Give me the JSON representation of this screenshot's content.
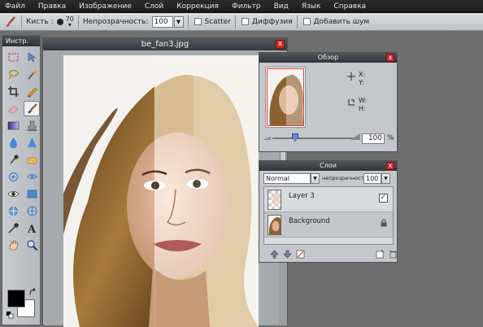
{
  "menu": [
    "Файл",
    "Правка",
    "Изображение",
    "Слой",
    "Коррекция",
    "Фильтр",
    "Вид",
    "Язык",
    "Справка"
  ],
  "options": {
    "brush_label": "Кисть :",
    "brush_size": "70",
    "opacity_label": "Непрозрачность:",
    "opacity_value": "100",
    "scatter_label": "Scatter",
    "diffusion_label": "Диффузия",
    "add_noise_label": "Добавить шум"
  },
  "tools": {
    "title": "Инстр.",
    "items": [
      "marquee",
      "move",
      "lasso",
      "magic-wand",
      "crop",
      "pencil",
      "eraser",
      "brush",
      "gradient",
      "stamp",
      "blur",
      "sharpen",
      "burn",
      "sponge",
      "dodge",
      "replace-color",
      "eye",
      "shape",
      "clone",
      "target",
      "eyedropper",
      "type",
      "hand",
      "zoom"
    ],
    "active": "brush",
    "fg_color": "#000000",
    "bg_color": "#ffffff"
  },
  "document": {
    "title": "be_fan3.jpg",
    "close": "x"
  },
  "navigator": {
    "title": "Обзор",
    "x_label": "X:",
    "y_label": "Y:",
    "w_label": "W:",
    "h_label": "H:",
    "zoom_value": "100",
    "zoom_unit": "%",
    "close": "x"
  },
  "layers": {
    "title": "Слои",
    "blend_mode": "Normal",
    "opacity_label": "непрозрачность:",
    "opacity_value": "100",
    "close": "x",
    "items": [
      {
        "name": "Layer 3",
        "visible": true
      },
      {
        "name": "Background",
        "locked": true
      }
    ]
  },
  "colors": {
    "accent": "#c92b2b",
    "panel": "#c4c8cc",
    "workspace": "#6e6e6e"
  }
}
